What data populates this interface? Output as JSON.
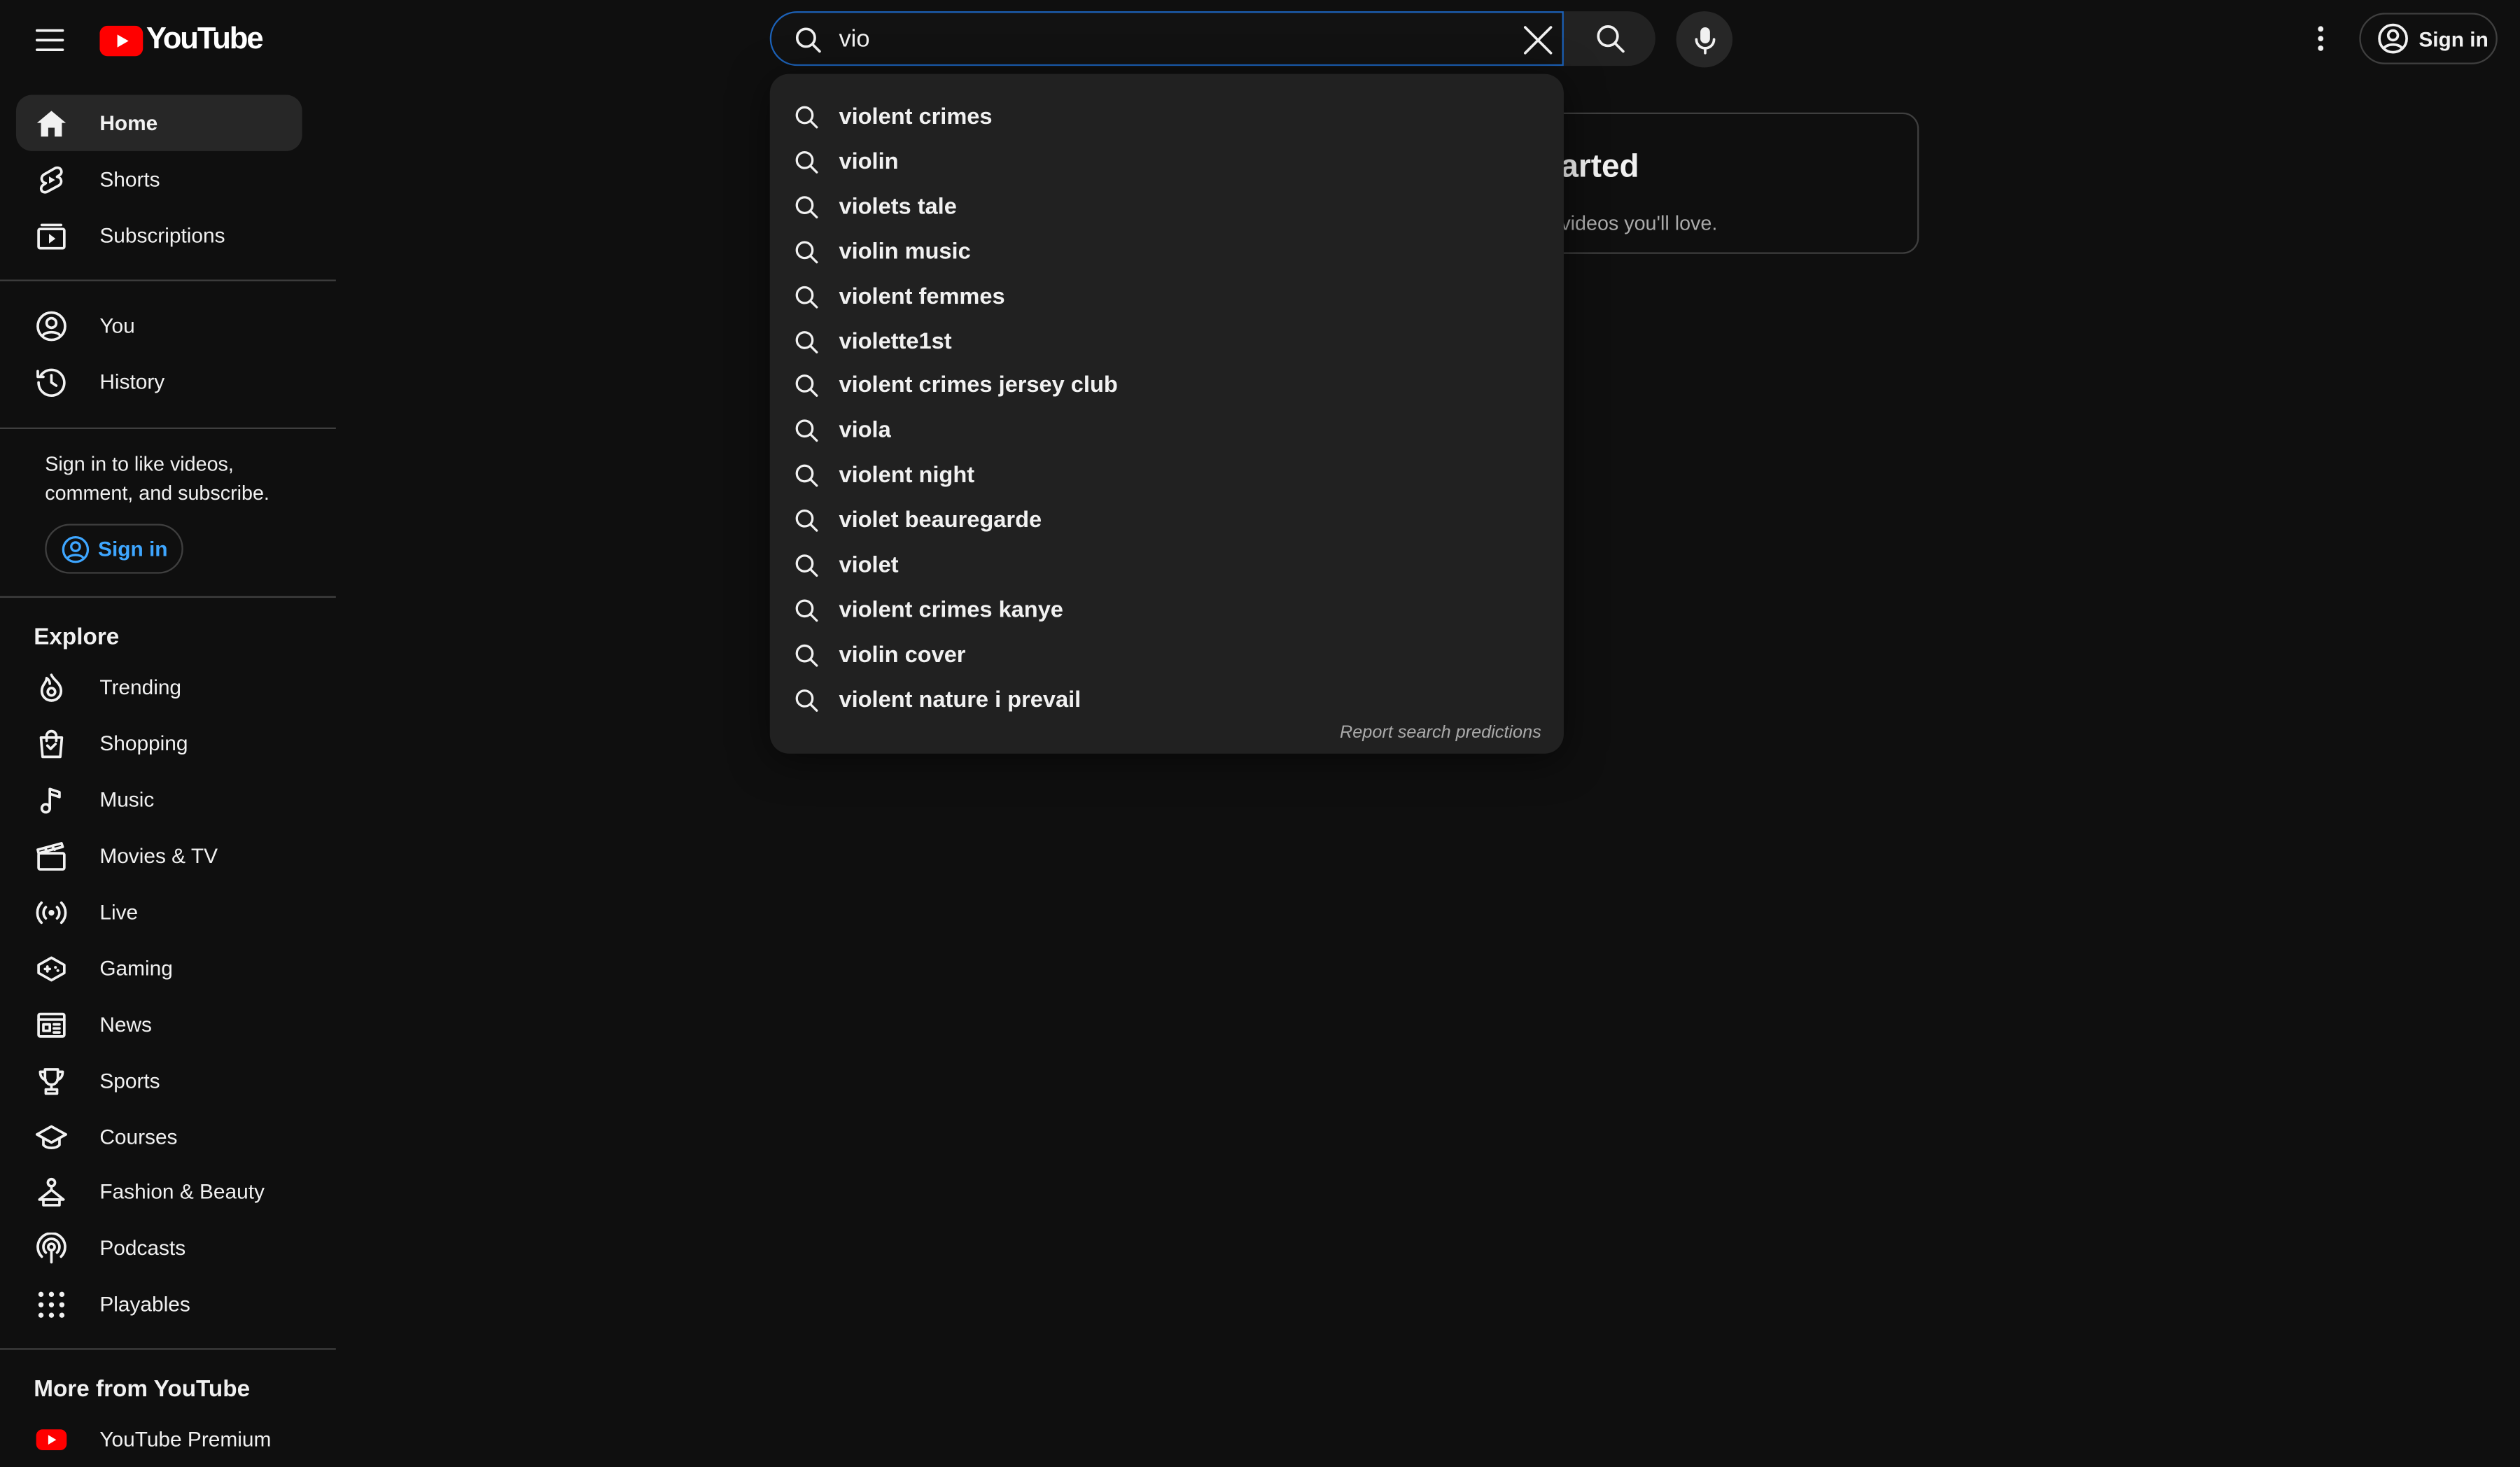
{
  "header": {
    "logo_text": "YouTube",
    "brand_color": "#ff0000",
    "menu_icon": "hamburger-menu-icon",
    "search": {
      "value": "vio",
      "placeholder": "Search"
    },
    "sign_in_label": "Sign in"
  },
  "sidebar": {
    "primary": [
      {
        "label": "Home",
        "icon": "home-icon",
        "active": true
      },
      {
        "label": "Shorts",
        "icon": "shorts-icon"
      },
      {
        "label": "Subscriptions",
        "icon": "subscriptions-icon"
      }
    ],
    "you": [
      {
        "label": "You",
        "icon": "account-icon"
      },
      {
        "label": "History",
        "icon": "history-icon"
      }
    ],
    "signin_message": "Sign in to like videos, comment, and subscribe.",
    "signin_label": "Sign in",
    "explore_title": "Explore",
    "explore": [
      {
        "label": "Trending",
        "icon": "trending-icon"
      },
      {
        "label": "Shopping",
        "icon": "shopping-bag-icon"
      },
      {
        "label": "Music",
        "icon": "music-note-icon"
      },
      {
        "label": "Movies & TV",
        "icon": "clapperboard-icon"
      },
      {
        "label": "Live",
        "icon": "live-broadcast-icon"
      },
      {
        "label": "Gaming",
        "icon": "gamepad-icon"
      },
      {
        "label": "News",
        "icon": "newspaper-icon"
      },
      {
        "label": "Sports",
        "icon": "trophy-icon"
      },
      {
        "label": "Courses",
        "icon": "graduation-cap-icon"
      },
      {
        "label": "Fashion & Beauty",
        "icon": "hanger-icon"
      },
      {
        "label": "Podcasts",
        "icon": "podcast-icon"
      },
      {
        "label": "Playables",
        "icon": "dots-grid-icon"
      }
    ],
    "more_title": "More from YouTube",
    "more": [
      {
        "label": "YouTube Premium",
        "icon": "youtube-premium-icon"
      }
    ]
  },
  "background_card": {
    "title": "arted",
    "subtitle": "videos you'll love."
  },
  "suggestions": {
    "items": [
      "violent crimes",
      "violin",
      "violets tale",
      "violin music",
      "violent femmes",
      "violette1st",
      "violent crimes jersey club",
      "viola",
      "violent night",
      "violet beauregarde",
      "violet",
      "violent crimes kanye",
      "violin cover",
      "violent nature i prevail"
    ],
    "report_label": "Report search predictions"
  }
}
